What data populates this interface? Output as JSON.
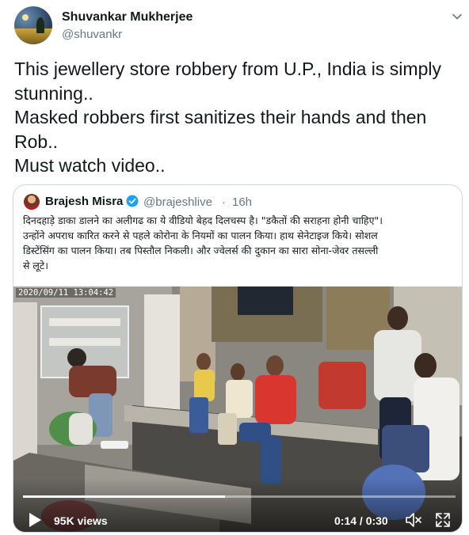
{
  "author": {
    "name": "Shuvankar Mukherjee",
    "handle": "@shuvankr",
    "avatar_icon": "starry-night-avatar-icon"
  },
  "tweet": {
    "lines": [
      "This jewellery store robbery from U.P., India is simply",
      "stunning..",
      "Masked robbers first sanitizes their hands and then",
      "Rob..",
      "Must watch video.."
    ]
  },
  "quoted_tweet": {
    "name": "Brajesh Misra",
    "verified": true,
    "handle": "@brajeshlive",
    "separator": "·",
    "time": "16h",
    "lines": [
      "दिनदहाड़े डाका डालने का अलीगढ का ये वीडियो बेहद दिलचस्प है। \"डकैतों की सराहना होनी चाहिए\"।",
      "उन्होंने अपराध कारित करने से पहले कोरोना के नियमों का पालन किया। हाथ सेनेटाइज किये। सोशल",
      "डिस्टेंसिंग का पालन किया। तब पिस्तौल निकली। और ज्वेलर्स की दुकान का सारा सोना-जेवर तसल्ली",
      "से लूटे।"
    ]
  },
  "video": {
    "cctv_timestamp": "2020/09/11  13:04:42",
    "views": "95K views",
    "time_display": "0:14 / 0:30",
    "progress_fraction": 0.467
  },
  "colors": {
    "text": "#14171a",
    "secondary_text": "#657786",
    "verified": "#1da1f2",
    "border": "#ccd6dd"
  }
}
